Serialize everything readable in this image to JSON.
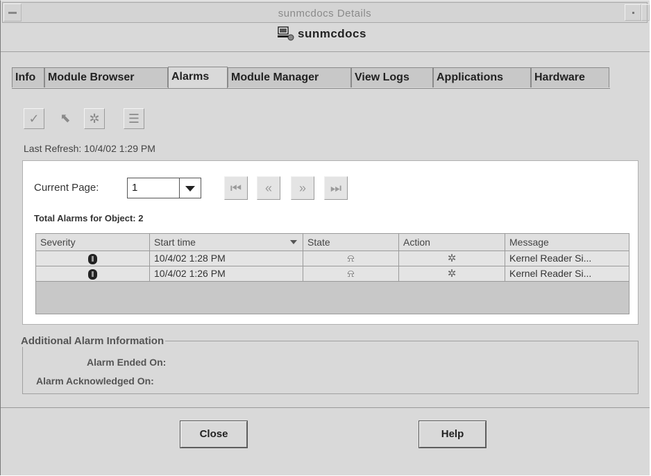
{
  "window": {
    "title": "sunmcdocs Details"
  },
  "header": {
    "host_name": "sunmcdocs",
    "host_icon": "host-icon"
  },
  "tabs": [
    {
      "label": "Info",
      "active": false
    },
    {
      "label": "Module Browser",
      "active": false
    },
    {
      "label": "Alarms",
      "active": true
    },
    {
      "label": "Module Manager",
      "active": false
    },
    {
      "label": "View Logs",
      "active": false
    },
    {
      "label": "Applications",
      "active": false
    },
    {
      "label": "Hardware",
      "active": false
    }
  ],
  "toolbar": {
    "buttons": [
      {
        "name": "acknowledge-alarm-icon",
        "glyph": "✓"
      },
      {
        "name": "delete-alarm-icon",
        "glyph": "⬉"
      },
      {
        "name": "fix-alarm-icon",
        "glyph": "✲"
      },
      {
        "name": "column-chooser-icon",
        "glyph": "☰"
      }
    ],
    "last_refresh": "Last Refresh: 10/4/02 1:29 PM"
  },
  "paging": {
    "label": "Current Page:",
    "current_page": "1",
    "nav": [
      {
        "name": "first-page-button",
        "glyph": "⏮"
      },
      {
        "name": "prev-page-button",
        "glyph": "«"
      },
      {
        "name": "next-page-button",
        "glyph": "»"
      },
      {
        "name": "last-page-button",
        "glyph": "⏭"
      }
    ]
  },
  "alarms": {
    "total_label": "Total Alarms for Object: 2",
    "columns": [
      "Severity",
      "Start time",
      "State",
      "Action",
      "Message"
    ],
    "sorted_column": "Start time",
    "rows": [
      {
        "severity": "critical",
        "start_time": "10/4/02 1:28 PM",
        "state": "open",
        "action": "fix",
        "message": "Kernel Reader Si..."
      },
      {
        "severity": "critical",
        "start_time": "10/4/02 1:26 PM",
        "state": "open",
        "action": "fix",
        "message": "Kernel Reader Si..."
      }
    ]
  },
  "additional_info": {
    "title": "Additional Alarm Information",
    "ended_label": "Alarm Ended On:",
    "acknowledged_label": "Alarm Acknowledged On:"
  },
  "buttons": {
    "close": "Close",
    "help": "Help"
  }
}
